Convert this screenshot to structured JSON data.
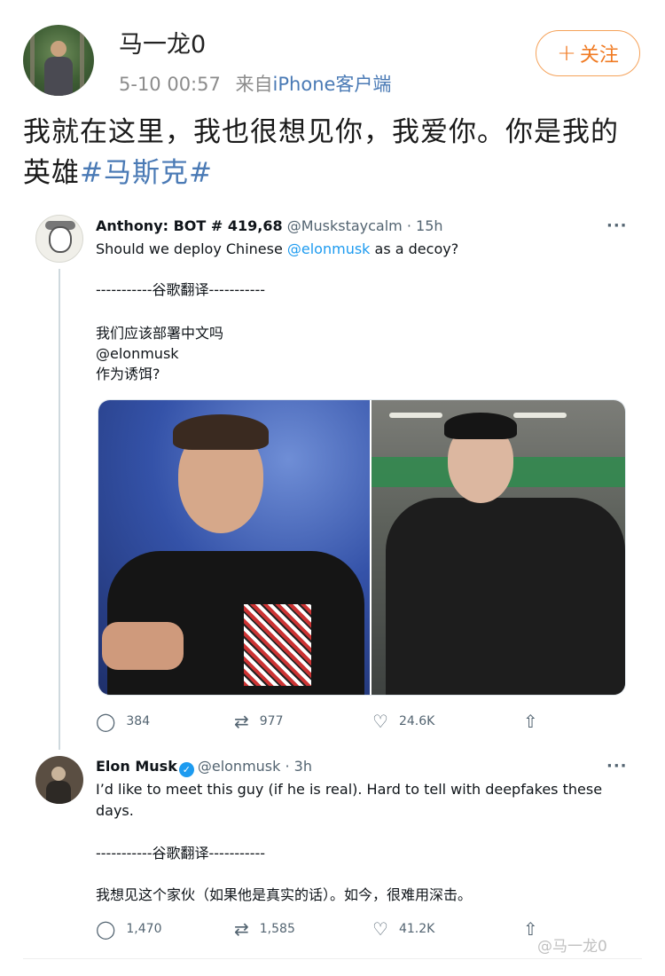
{
  "weibo": {
    "author": "马一龙0",
    "timestamp": "5-10 00:57",
    "source_prefix": "来自",
    "source": "iPhone客户端",
    "follow_label": "关注",
    "follow_icon": "+",
    "text": "我就在这里，我也很想见你，我爱你。你是我的英雄",
    "hashtag": "#马斯克#"
  },
  "tweet1": {
    "name": "Anthony: BOT # 419,68",
    "handle": "@Muskstaycalm · 15h",
    "text_before": "Should we deploy Chinese ",
    "mention": "@elonmusk",
    "text_after": " as a decoy?",
    "separator": "-----------谷歌翻译-----------",
    "translation_line1": "我们应该部署中文吗",
    "translation_line2": "@elonmusk",
    "translation_line3": "作为诱饵?",
    "replies": "384",
    "retweets": "977",
    "likes": "24.6K"
  },
  "tweet2": {
    "name": "Elon Musk",
    "handle": "@elonmusk · 3h",
    "text_line1": "I’d like to meet this guy (if he is real). Hard to tell with deepfakes these",
    "text_line2": "days.",
    "separator": "-----------谷歌翻译-----------",
    "translation": "我想见这个家伙（如果他是真实的话）。如今，很难用深击。",
    "replies": "1,470",
    "retweets": "1,585",
    "likes": "41.2K"
  },
  "more_icon": "···",
  "icons": {
    "reply": "reply-icon",
    "retweet": "retweet-icon",
    "like": "heart-icon",
    "share": "share-icon",
    "verified": "verified-badge-icon"
  },
  "watermark": "@马一龙0",
  "colors": {
    "follow": "#f07b23",
    "weibo_link": "#4a7ab5",
    "twitter_blue": "#1d9bf0"
  }
}
